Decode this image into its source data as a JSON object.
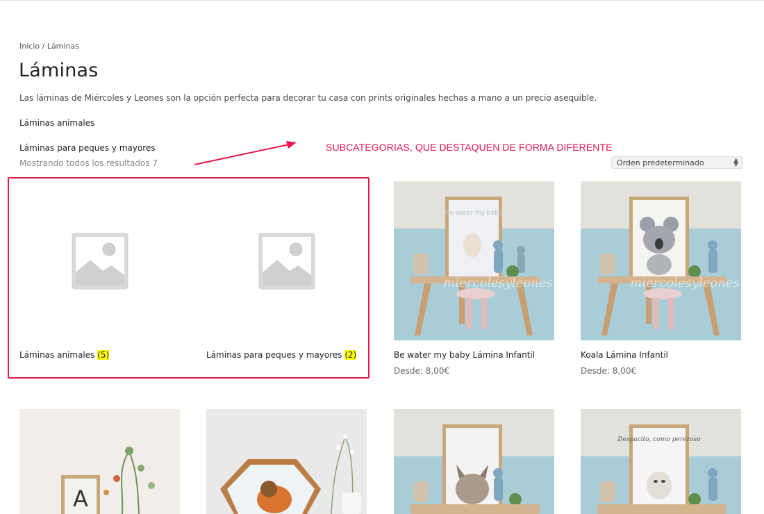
{
  "breadcrumb": {
    "home": "Inicio",
    "separator": " / ",
    "current": "Láminas"
  },
  "page_title": "Láminas",
  "description": "Las láminas de Miércoles y Leones son la opción perfecta para decorar tu casa con prints originales hechas a mano a un precio asequible.",
  "subcategory_links": [
    "Láminas animales",
    "Láminas para peques y mayores"
  ],
  "result_count": "Mostrando todos los resultados 7",
  "annotation": {
    "text": "SUBCATEGORIAS, QUE DESTAQUEN DE FORMA DIFERENTE",
    "color": "#e8174a"
  },
  "orderby": {
    "selected": "Orden predeterminado"
  },
  "categories": [
    {
      "name": "Láminas animales ",
      "count": "(5)"
    },
    {
      "name": "Láminas para peques y mayores ",
      "count": "(2)"
    }
  ],
  "products": [
    {
      "name": "Be water my baby Lámina Infantil",
      "price": "Desde: 8,00€"
    },
    {
      "name": "Koala Lámina Infantil",
      "price": "Desde: 8,00€"
    }
  ],
  "image_texts": {
    "watermark": "miercolesyleones",
    "letter": "A",
    "art_be_water": "Be water my baby",
    "art_despacito": "Despacito, como perezoso"
  },
  "colors": {
    "accent": "#e8174a",
    "count_highlight": "#ffff00",
    "wall_blue": "#a9cdd6",
    "wall_gray": "#e2e0da"
  }
}
